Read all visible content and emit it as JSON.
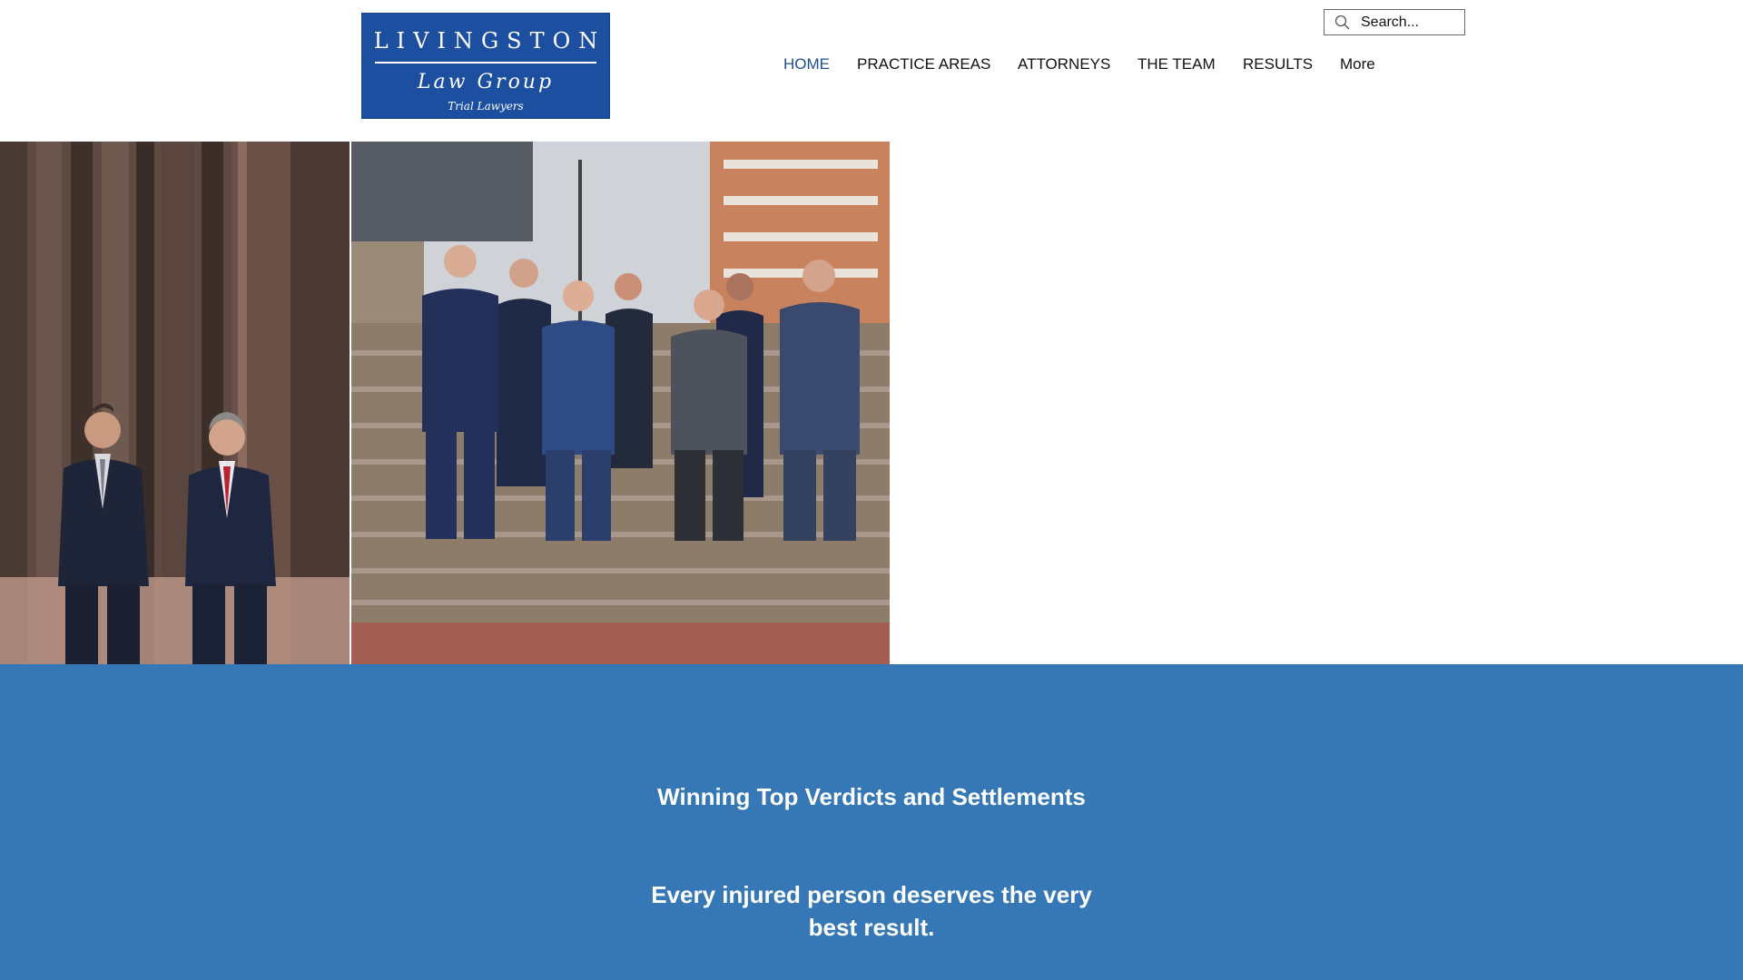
{
  "brand": {
    "line1": "LIVINGSTON",
    "line2": "Law Group",
    "line3": "Trial Lawyers",
    "color": "#1d4fa0"
  },
  "search": {
    "placeholder": "Search...",
    "icon": "search-icon"
  },
  "nav": {
    "items": [
      {
        "label": "HOME",
        "active": true
      },
      {
        "label": "PRACTICE AREAS",
        "active": false
      },
      {
        "label": "ATTORNEYS",
        "active": false
      },
      {
        "label": "THE TEAM",
        "active": false
      },
      {
        "label": "RESULTS",
        "active": false
      },
      {
        "label": "More",
        "active": false
      }
    ],
    "active_color": "#1b4f90"
  },
  "hero": {
    "photos": [
      "founding-partners-photo",
      "team-group-photo"
    ]
  },
  "banner": {
    "heading": "Winning Top Verdicts and Settlements",
    "tagline": "Every injured person deserves the very best result.",
    "color": "#3578b5"
  }
}
